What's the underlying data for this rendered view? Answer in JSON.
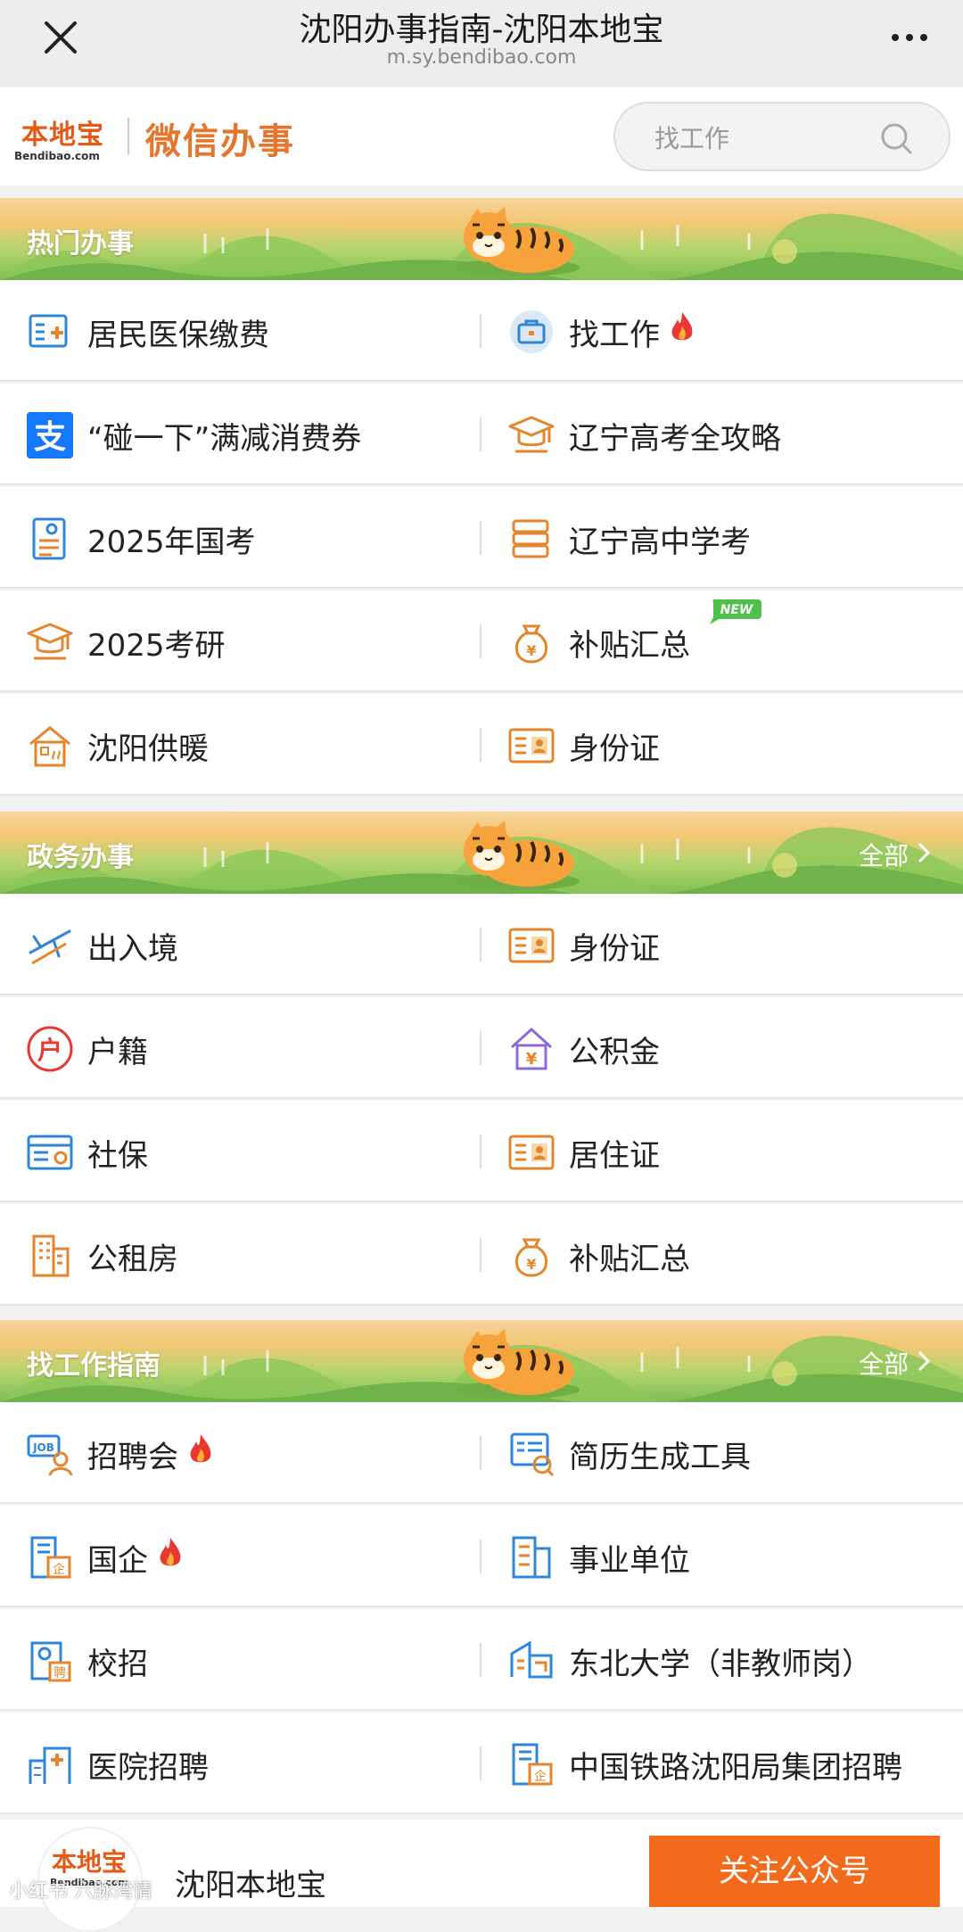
{
  "nav": {
    "title": "沈阳办事指南-沈阳本地宝",
    "url": "m.sy.bendibao.com"
  },
  "header": {
    "logo_text": "本地宝",
    "logo_sub": "Bendibao.com",
    "brand": "微信办事",
    "search_placeholder": "找工作"
  },
  "sections": {
    "hot": {
      "title": "热门办事",
      "items": [
        {
          "label": "居民医保缴费",
          "icon": "medical-card-icon"
        },
        {
          "label": "找工作",
          "icon": "briefcase-icon",
          "hot": true
        },
        {
          "label": "“碰一下”满减消费券",
          "icon": "alipay-icon"
        },
        {
          "label": "辽宁高考全攻略",
          "icon": "graduation-cap-icon"
        },
        {
          "label": "2025年国考",
          "icon": "exam-document-icon"
        },
        {
          "label": "辽宁高中学考",
          "icon": "books-icon"
        },
        {
          "label": "2025考研",
          "icon": "graduation-cap-icon"
        },
        {
          "label": "补贴汇总",
          "icon": "money-bag-icon",
          "badge": "NEW"
        },
        {
          "label": "沈阳供暖",
          "icon": "heating-house-icon"
        },
        {
          "label": "身份证",
          "icon": "id-card-icon"
        }
      ]
    },
    "gov": {
      "title": "政务办事",
      "all": "全部",
      "items": [
        {
          "label": "出入境",
          "icon": "airplane-icon"
        },
        {
          "label": "身份证",
          "icon": "id-card-icon"
        },
        {
          "label": "户籍",
          "icon": "household-icon"
        },
        {
          "label": "公积金",
          "icon": "housing-fund-icon"
        },
        {
          "label": "社保",
          "icon": "social-security-card-icon"
        },
        {
          "label": "居住证",
          "icon": "id-card-icon"
        },
        {
          "label": "公租房",
          "icon": "building-icon"
        },
        {
          "label": "补贴汇总",
          "icon": "money-bag-icon"
        }
      ]
    },
    "job": {
      "title": "找工作指南",
      "all": "全部",
      "items": [
        {
          "label": "招聘会",
          "icon": "job-fair-icon",
          "hot": true
        },
        {
          "label": "简历生成工具",
          "icon": "resume-icon"
        },
        {
          "label": "国企",
          "icon": "state-enterprise-icon",
          "hot": true
        },
        {
          "label": "事业单位",
          "icon": "institution-building-icon"
        },
        {
          "label": "校招",
          "icon": "campus-recruit-icon"
        },
        {
          "label": "东北大学（非教师岗）",
          "icon": "university-icon"
        },
        {
          "label": "医院招聘",
          "icon": "hospital-icon"
        },
        {
          "label": "中国铁路沈阳局集团招聘",
          "icon": "railway-enterprise-icon"
        }
      ]
    }
  },
  "footer": {
    "logo_text": "本地宝",
    "logo_sub": "Bendibao.com",
    "name": "沈阳本地宝",
    "follow_button": "关注公众号",
    "watermark": "小红书 六脉湾情"
  },
  "colors": {
    "accent_orange": "#f26b1d",
    "icon_blue": "#2f86d6",
    "icon_orange": "#e4862d",
    "hot_red": "#e8382f"
  }
}
